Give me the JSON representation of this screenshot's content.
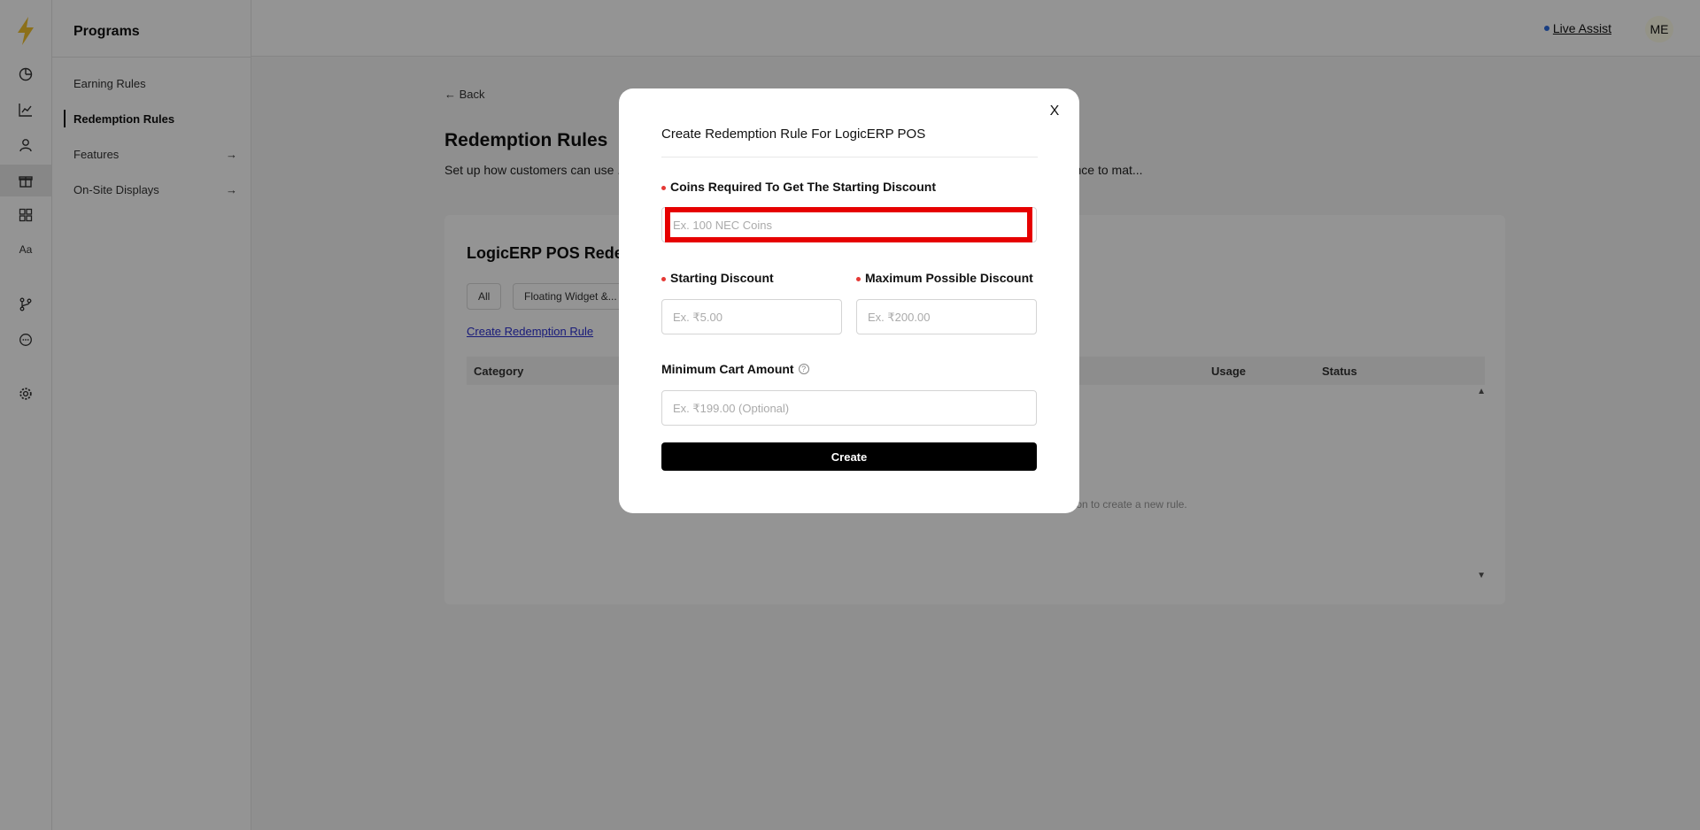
{
  "sidebar": {
    "title": "Programs",
    "items": [
      {
        "label": "Earning Rules"
      },
      {
        "label": "Redemption Rules"
      },
      {
        "label": "Features"
      },
      {
        "label": "On-Site Displays"
      }
    ]
  },
  "rail": {
    "icons": [
      "bolt-logo-icon",
      "pie-chart-icon",
      "line-chart-icon",
      "user-icon",
      "gift-icon",
      "blocks-icon",
      "font-icon",
      "branch-icon",
      "chat-icon",
      "gear-icon"
    ],
    "font_label": "Aa"
  },
  "header": {
    "live_assist": "Live Assist",
    "avatar": "ME"
  },
  "main": {
    "back": "Back",
    "title": "Redemption Rules",
    "description": "Set up how customers can use ... ocking free products, or accessing exclusive offers. Tailor the redemption experience to mat...",
    "card_title": "LogicERP POS Rede...",
    "filters": [
      "All",
      "Floating Widget &..."
    ],
    "create_link": "Create Redemption Rule",
    "columns": [
      "Category",
      "Usage",
      "Status"
    ],
    "empty_text": "...ton to create a new rule."
  },
  "modal": {
    "title": "Create Redemption Rule For LogicERP POS",
    "coins_label": "Coins Required To Get The Starting Discount",
    "coins_placeholder": "Ex. 100 NEC Coins",
    "starting_label": "Starting Discount",
    "starting_placeholder": "Ex. ₹5.00",
    "max_label": "Maximum Possible Discount",
    "max_placeholder": "Ex. ₹200.00",
    "min_cart_label": "Minimum Cart Amount",
    "min_cart_placeholder": "Ex. ₹199.00 (Optional)",
    "create": "Create",
    "close": "X"
  },
  "colors": {
    "required": "#e53935",
    "highlight": "#e60000",
    "link": "#2b2fd1",
    "live_dot": "#2c6be0"
  }
}
